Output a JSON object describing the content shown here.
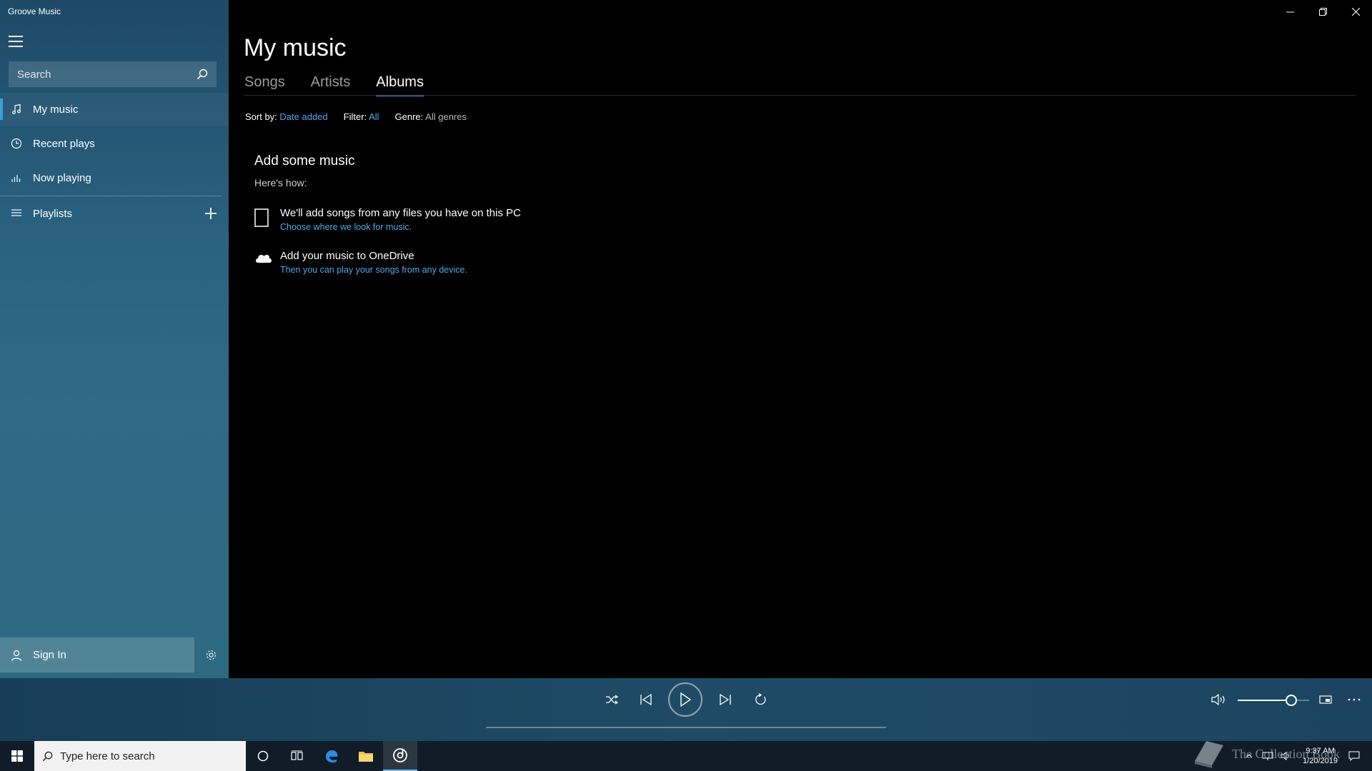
{
  "app": {
    "title": "Groove Music"
  },
  "sidebar": {
    "search_placeholder": "Search",
    "items": [
      {
        "label": "My music",
        "icon": "music-note-icon"
      },
      {
        "label": "Recent plays",
        "icon": "clock-icon"
      },
      {
        "label": "Now playing",
        "icon": "equalizer-icon"
      },
      {
        "label": "Playlists",
        "icon": "list-icon"
      }
    ],
    "sign_in": "Sign In"
  },
  "main": {
    "title": "My music",
    "tabs": [
      {
        "label": "Songs",
        "active": false
      },
      {
        "label": "Artists",
        "active": false
      },
      {
        "label": "Albums",
        "active": true
      }
    ],
    "filters": {
      "sort_label": "Sort by:",
      "sort_value": "Date added",
      "filter_label": "Filter:",
      "filter_value": "All",
      "genre_label": "Genre:",
      "genre_value": "All genres"
    },
    "empty": {
      "title": "Add some music",
      "subtitle": "Here's how:",
      "rows": [
        {
          "title": "We'll add songs from any files you have on this PC",
          "link": "Choose where we look for music.",
          "icon": "device-icon"
        },
        {
          "title": "Add your music to OneDrive",
          "link": "Then you can play your songs from any device.",
          "icon": "cloud-icon"
        }
      ]
    }
  },
  "player": {
    "volume_fraction": 0.75
  },
  "taskbar": {
    "search_placeholder": "Type here to search",
    "time": "9:37 AM",
    "date": "1/20/2019",
    "watermark": "The Collection Book"
  },
  "colors": {
    "accent": "#3a9ddc",
    "link": "#4ea8e6",
    "sidebar": "#2a6280"
  }
}
